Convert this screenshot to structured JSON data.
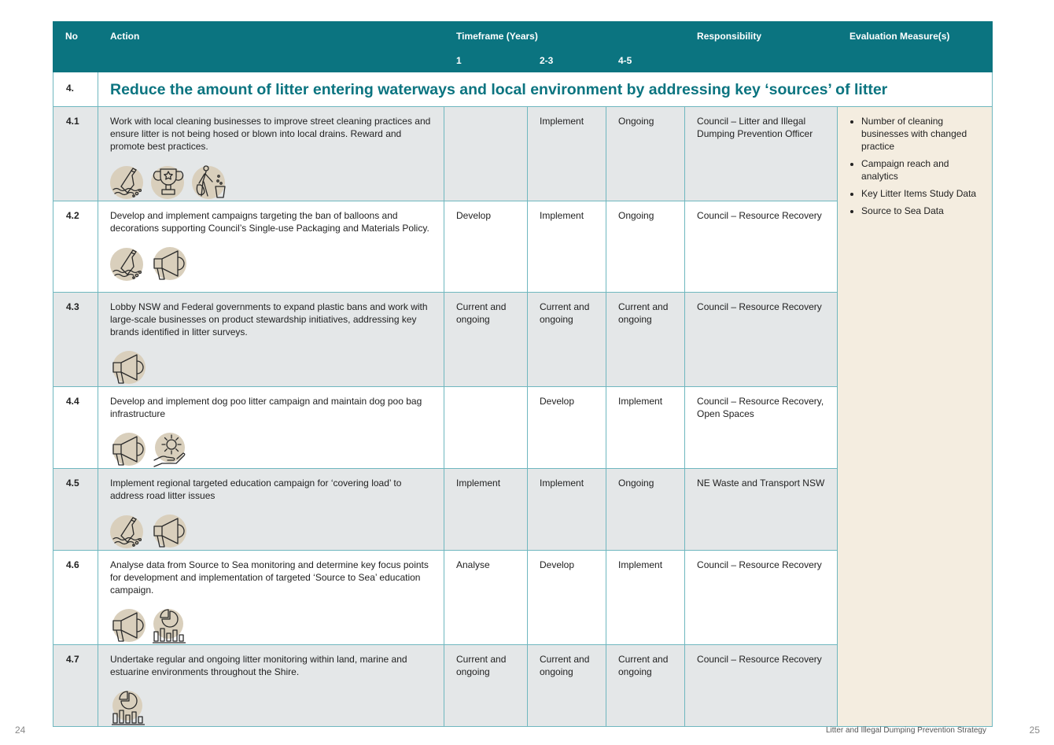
{
  "header": {
    "no": "No",
    "action": "Action",
    "timeframe": "Timeframe (Years)",
    "responsibility": "Responsibility",
    "evaluation": "Evaluation Measure(s)",
    "year1": "1",
    "year2": "2-3",
    "year3": "4-5"
  },
  "section": {
    "number": "4.",
    "title": "Reduce the amount of litter entering waterways and local environment by addressing key ‘sources’ of litter"
  },
  "rows": [
    {
      "no": "4.1",
      "action": "Work with local cleaning businesses to improve street cleaning practices and ensure litter is not being hosed or blown into local drains. Reward and promote best practices.",
      "y1": "",
      "y2": "Implement",
      "y3": "Ongoing",
      "responsibility": "Council – Litter and Illegal Dumping Prevention Officer",
      "icons": [
        "bottle-water-icon",
        "trophy-icon",
        "person-bin-icon"
      ]
    },
    {
      "no": "4.2",
      "action": "Develop and implement campaigns targeting the ban of balloons and decorations supporting Council’s Single-use Packaging and Materials Policy.",
      "y1": "Develop",
      "y2": "Implement",
      "y3": "Ongoing",
      "responsibility": "Council – Resource Recovery",
      "icons": [
        "bottle-water-icon",
        "megaphone-icon"
      ]
    },
    {
      "no": "4.3",
      "action": "Lobby NSW and Federal governments to expand plastic bans and work with large-scale businesses on product stewardship initiatives, addressing key brands identified in litter surveys.",
      "y1": "Current and ongoing",
      "y2": "Current and ongoing",
      "y3": "Current and ongoing",
      "responsibility": "Council – Resource Recovery",
      "icons": [
        "megaphone-icon"
      ]
    },
    {
      "no": "4.4",
      "action": "Develop and implement dog poo litter campaign and maintain dog poo bag infrastructure",
      "y1": "",
      "y2": "Develop",
      "y3": "Implement",
      "responsibility": "Council – Resource Recovery, Open Spaces",
      "icons": [
        "megaphone-icon",
        "gear-hand-icon"
      ]
    },
    {
      "no": "4.5",
      "action": "Implement regional targeted education campaign for ‘covering load’ to address road litter issues",
      "y1": "Implement",
      "y2": "Implement",
      "y3": "Ongoing",
      "responsibility": "NE Waste   and Transport NSW",
      "icons": [
        "bottle-water-icon",
        "megaphone-icon"
      ]
    },
    {
      "no": "4.6",
      "action": "Analyse data from Source to Sea monitoring and determine key focus points for development and implementation of targeted ‘Source to Sea’ education campaign.",
      "y1": "Analyse",
      "y2": "Develop",
      "y3": "Implement",
      "responsibility": "Council – Resource Recovery",
      "icons": [
        "megaphone-icon",
        "chart-icon"
      ]
    },
    {
      "no": "4.7",
      "action": "Undertake regular and ongoing litter monitoring within land, marine and estuarine environments throughout the Shire.",
      "y1": "Current and ongoing",
      "y2": "Current and ongoing",
      "y3": "Current and ongoing",
      "responsibility": "Council – Resource Recovery",
      "icons": [
        "chart-icon"
      ]
    }
  ],
  "evaluation": [
    "Number of cleaning businesses with changed practice",
    "Campaign reach and analytics",
    "Key Litter Items Study Data",
    "Source to Sea Data"
  ],
  "footer": {
    "left_page": "24",
    "doc_title": "Litter and Illegal Dumping Prevention Strategy",
    "right_page": "25"
  },
  "colors": {
    "header_teal": "#0b7480",
    "row_shade": "#e4e7e8",
    "eval_bg": "#f4ede0",
    "icon_circle": "#d9cfbc"
  }
}
